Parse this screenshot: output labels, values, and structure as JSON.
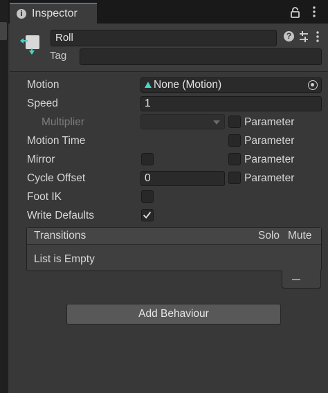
{
  "window": {
    "tab_title": "Inspector"
  },
  "header": {
    "name": "Roll",
    "tag_label": "Tag",
    "tag_value": ""
  },
  "properties": {
    "motion_label": "Motion",
    "motion_value": "None (Motion)",
    "speed_label": "Speed",
    "speed_value": "1",
    "multiplier_label": "Multiplier",
    "multiplier_value": "",
    "motion_time_label": "Motion Time",
    "mirror_label": "Mirror",
    "mirror_checked": false,
    "cycle_offset_label": "Cycle Offset",
    "cycle_offset_value": "0",
    "foot_ik_label": "Foot IK",
    "foot_ik_checked": false,
    "write_defaults_label": "Write Defaults",
    "write_defaults_checked": true,
    "parameter_label": "Parameter"
  },
  "transitions": {
    "title": "Transitions",
    "solo_label": "Solo",
    "mute_label": "Mute",
    "empty_text": "List is Empty"
  },
  "buttons": {
    "add_behaviour": "Add Behaviour"
  },
  "icons": {
    "tab": "info-icon",
    "lock": "lock-icon",
    "menu": "kebab-menu-icon",
    "state": "animator-state-icon",
    "help": "help-icon",
    "preset": "preset-sliders-icon",
    "motion_object": "motion-clip-icon",
    "picker": "object-picker-icon",
    "checkmark": "checkmark-icon",
    "remove": "minus-icon"
  },
  "colors": {
    "background": "#383838",
    "field": "#2a2a2a",
    "tab_accent": "#3a79bb",
    "state_icon_accent": "#4fd3c4",
    "button": "#585858"
  }
}
